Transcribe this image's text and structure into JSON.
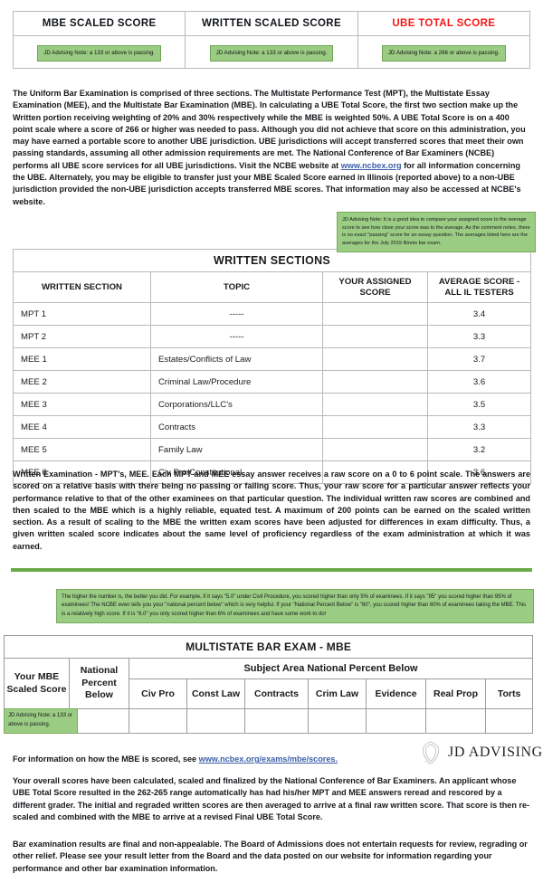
{
  "score_summary": {
    "columns": [
      {
        "header": "MBE SCALED SCORE",
        "note": "JD Advising Note: a 133 or above is passing.",
        "header_color": "#12161c"
      },
      {
        "header": "WRITTEN SCALED SCORE",
        "note": "JD Advising Note: a 133 or above is passing.",
        "header_color": "#12161c"
      },
      {
        "header": "UBE TOTAL SCORE",
        "note": "JD Advising Note: a 266 or above is passing.",
        "header_color": "#fb1616"
      }
    ]
  },
  "intro_paragraph": {
    "text_before_link": "The Uniform Bar Examination is comprised of three sections.  The Multistate Performance Test (MPT), the Multistate Essay Examination (MEE), and the Multistate Bar Examination (MBE). In calculating a UBE Total Score, the first two section make up the Written portion receiving weighting of 20% and 30% respectively while the MBE is weighted 50%. A UBE Total Score is on a 400 point scale where a score of 266 or higher was needed to pass. Although you did not achieve that score on this administration, you may have earned a portable score to another UBE jurisdiction.  UBE jurisdictions will accept transferred scores that meet their own passing standards, assuming all other admission requirements are met.   The National Conference of Bar Examiners (NCBE) performs all UBE score services for all UBE jurisdictions.  Visit the NCBE website at ",
    "link_text": "www.ncbex.org",
    "text_after_link": " for all information concerning the UBE.  Alternately, you may be eligible to transfer just your MBE Scaled Score earned in Illinois (reported above) to a non-UBE jurisdiction provided the non-UBE jurisdiction accepts transferred MBE scores. That information may also be accessed at NCBE's website."
  },
  "essay_advising_note": "JD Advising Note: It is a good idea to compare your assigned score to the average score to see how close your score was to the average. As the comment notes, there is no exact \"passing\" score for an essay question. The averages listed here are the averages for the July 2019 Illinois bar exam.",
  "written_sections": {
    "title": "WRITTEN SECTIONS",
    "headers": [
      "WRITTEN SECTION",
      "TOPIC",
      "YOUR ASSIGNED SCORE",
      "AVERAGE SCORE - ALL IL TESTERS"
    ],
    "rows": [
      {
        "section": "MPT 1",
        "topic": "-----",
        "assigned": "",
        "average": "3.4"
      },
      {
        "section": "MPT 2",
        "topic": "-----",
        "assigned": "",
        "average": "3.3"
      },
      {
        "section": "MEE 1",
        "topic": "Estates/Conflicts of Law",
        "assigned": "",
        "average": "3.7"
      },
      {
        "section": "MEE 2",
        "topic": "Criminal Law/Procedure",
        "assigned": "",
        "average": "3.6"
      },
      {
        "section": "MEE 3",
        "topic": "Corporations/LLC's",
        "assigned": "",
        "average": "3.5"
      },
      {
        "section": "MEE 4",
        "topic": "Contracts",
        "assigned": "",
        "average": "3.3"
      },
      {
        "section": "MEE 5",
        "topic": "Family Law",
        "assigned": "",
        "average": "3.2"
      },
      {
        "section": "MEE 6",
        "topic": "Civ Pro/Constitutional",
        "assigned": "",
        "average": "3.6"
      }
    ]
  },
  "written_exam_paragraph": "Written Examination - MPT's, MEE.  Each MPT and MEE essay answer receives a raw score on a 0 to 6 point scale. The answers are scored on a relative basis with there being no passing or failing score. Thus, your raw score for a particular answer reflects your performance relative to that of the other examinees on that particular question. The individual written raw scores are combined and then scaled to the MBE which is a highly reliable, equated test. A maximum of 200 points can be earned on the scaled written section. As a result of scaling to the MBE the written exam scores have been adjusted for differences in exam difficulty. Thus, a given written scaled score indicates about the same level of proficiency regardless of the exam administration at which it was earned.",
  "mbe_advising_note": "The higher the number is, the better you did. For example, if it says \"5.0\" under Civil Procedure, you scored higher than only 5% of examinees.  If it says \"95\" you scored higher than 95% of examinees! The NCBE even tells you your \"national percent below\" which is very helpful. If your \"National Percent Below\" is \"60\", you scored higher than 60% of examinees taking the MBE. This is a relatively high score. If it is \"6.0\" you only scored higher than 6% of examinees and have some work to do!",
  "mbe_table": {
    "title": "MULTISTATE BAR EXAM - MBE",
    "stub_headers": [
      "Your MBE Scaled Score",
      "National Percent Below"
    ],
    "group_header": "Subject Area National Percent Below",
    "subject_headers": [
      "Civ Pro",
      "Const Law",
      "Contracts",
      "Crim Law",
      "Evidence",
      "Real Prop",
      "Torts"
    ],
    "row_values": [
      "",
      "",
      "",
      "",
      "",
      "",
      "",
      "",
      ""
    ],
    "score_cell_note": "JD Advising Note: a 133 or above is passing."
  },
  "mbe_info_line": {
    "text_before_link": "For information on how the MBE is scored, see ",
    "link_text": "www.ncbex.org/exams/mbe/scores."
  },
  "logo": {
    "text": "JD ADVISING",
    "icon": "jd-advising-seal-icon"
  },
  "closing_paragraphs": [
    "Your overall scores have been calculated, scaled and finalized by the National Conference of Bar Examiners.  An applicant whose UBE Total Score resulted in the 262-265 range automatically has had his/her MPT and MEE answers reread and rescored by a different grader.  The initial and regraded written scores are then averaged to arrive at a final raw written score. That score is then re-scaled and combined with the MBE to arrive at a revised Final UBE Total Score.",
    "Bar examination results are final and non-appealable. The Board of Admissions does not entertain requests for review, regrading or other relief. Please see your result letter from the Board and the data posted on our website for information regarding your performance and other bar examination information."
  ],
  "colors": {
    "note_green_bg": "#9bcc83",
    "note_green_border": "#78ad5b",
    "divider_green": "#6aaa4a",
    "ube_red": "#fb1616",
    "link_blue": "#3b5fa8"
  }
}
